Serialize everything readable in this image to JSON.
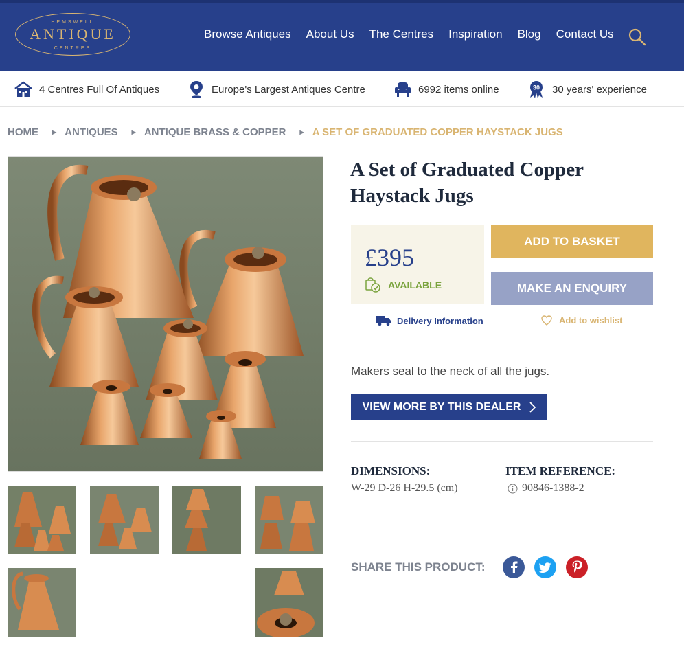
{
  "header": {
    "logo": {
      "top": "HEMSWELL",
      "main": "ANTIQUE",
      "bottom": "CENTRES"
    },
    "nav": [
      "Browse Antiques",
      "About Us",
      "The Centres",
      "Inspiration",
      "Blog",
      "Contact Us"
    ],
    "search_icon": "search-icon"
  },
  "features": [
    {
      "icon": "house-icon",
      "label": "4 Centres Full Of Antiques"
    },
    {
      "icon": "map-pin-icon",
      "label": "Europe's Largest Antiques Centre"
    },
    {
      "icon": "armchair-icon",
      "label": "6992 items online"
    },
    {
      "icon": "badge-30-icon",
      "label": "30 years' experience",
      "badge_text": "30"
    }
  ],
  "breadcrumb": [
    "HOME",
    "ANTIQUES",
    "ANTIQUE BRASS & COPPER",
    "A SET OF GRADUATED COPPER HAYSTACK JUGS"
  ],
  "product": {
    "title": "A Set of Graduated Copper Haystack Jugs",
    "price": "£395",
    "availability": "AVAILABLE",
    "add_to_basket": "ADD TO BASKET",
    "make_enquiry": "MAKE AN ENQUIRY",
    "delivery": "Delivery Information",
    "wishlist": "Add to wishlist",
    "description": "Makers seal to the neck of all the jugs.",
    "view_more": "VIEW MORE BY THIS DEALER",
    "dimensions_label": "DIMENSIONS:",
    "dimensions_value": "W-29 D-26 H-29.5 (cm)",
    "reference_label": "ITEM REFERENCE:",
    "reference_value": "90846-1388-2",
    "share_label": "SHARE THIS PRODUCT:",
    "social": [
      {
        "name": "facebook",
        "glyph": "f",
        "color": "#3b5998"
      },
      {
        "name": "twitter",
        "glyph": "t",
        "color": "#1da1f2"
      },
      {
        "name": "pinterest",
        "glyph": "p",
        "color": "#cb2027"
      }
    ]
  },
  "colors": {
    "header_blue": "#27408b",
    "gold": "#d9b572",
    "basket_gold": "#e0b55e",
    "enquiry_lavender": "#97a2c6",
    "available_green": "#7aa33d",
    "photo_background": "#7a8670",
    "copper": "#c8773f"
  }
}
